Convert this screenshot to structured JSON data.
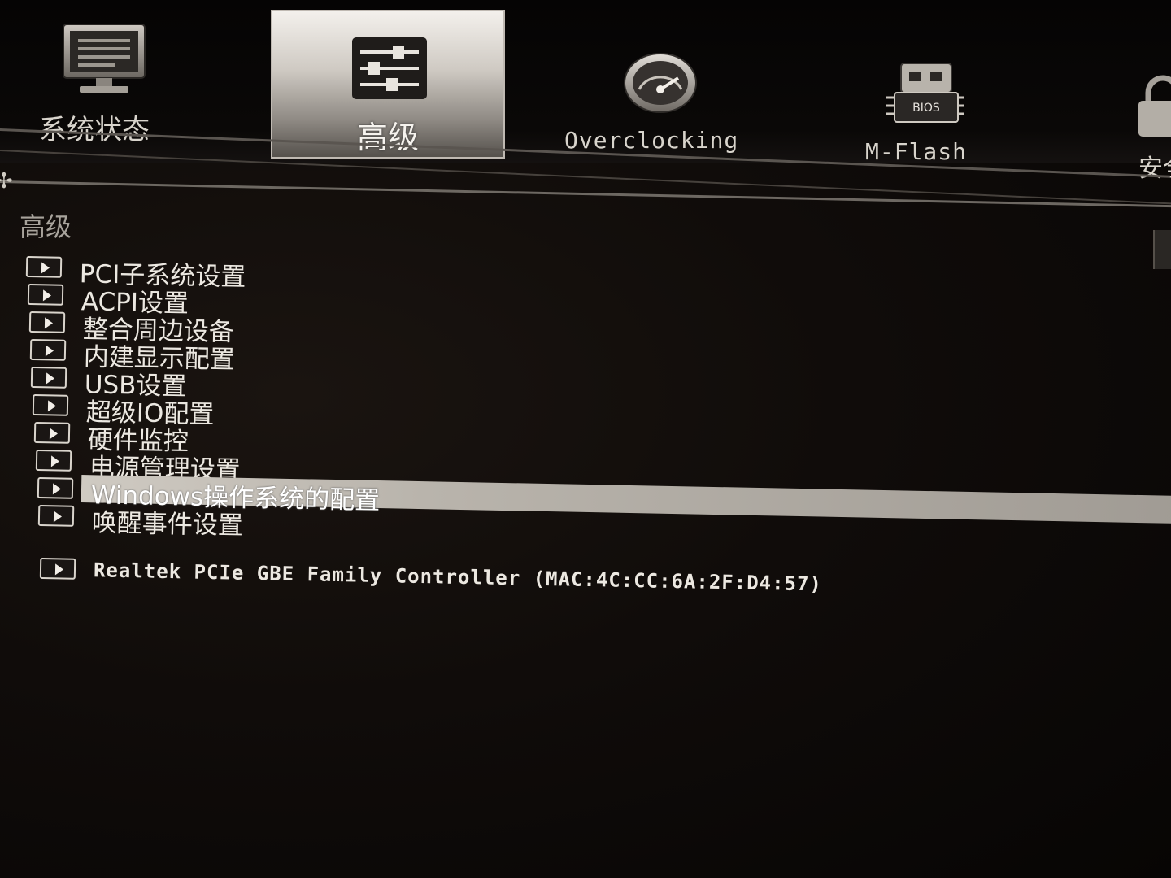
{
  "tabs": [
    {
      "label": "系统状态",
      "icon": "monitor-icon"
    },
    {
      "label": "高级",
      "icon": "settings-sliders-icon",
      "active": true
    },
    {
      "label": "Overclocking",
      "icon": "speedometer-icon"
    },
    {
      "label": "M-Flash",
      "icon": "bios-chip-icon"
    },
    {
      "label": "安全",
      "icon": "padlock-icon"
    }
  ],
  "bios_chip_text": "BIOS",
  "section_title": "高级",
  "menu_items": [
    {
      "label": "PCI子系统设置",
      "icon": "arrow-right-icon"
    },
    {
      "label": "ACPI设置",
      "icon": "arrow-right-icon"
    },
    {
      "label": "整合周边设备",
      "icon": "arrow-right-icon"
    },
    {
      "label": "内建显示配置",
      "icon": "arrow-right-icon"
    },
    {
      "label": "USB设置",
      "icon": "arrow-right-icon"
    },
    {
      "label": "超级IO配置",
      "icon": "arrow-right-icon"
    },
    {
      "label": "硬件监控",
      "icon": "arrow-right-icon"
    },
    {
      "label": "电源管理设置",
      "icon": "arrow-right-icon"
    },
    {
      "label": "Windows操作系统的配置",
      "icon": "arrow-right-icon",
      "selected": true
    },
    {
      "label": "唤醒事件设置",
      "icon": "arrow-right-icon"
    }
  ],
  "network_item": {
    "label": "Realtek PCIe GBE Family Controller (MAC:4C:CC:6A:2F:D4:57)",
    "icon": "arrow-right-icon"
  },
  "colors": {
    "background": "#0b0806",
    "text": "#ece8e1",
    "selected_highlight": "#b9b4ac"
  }
}
